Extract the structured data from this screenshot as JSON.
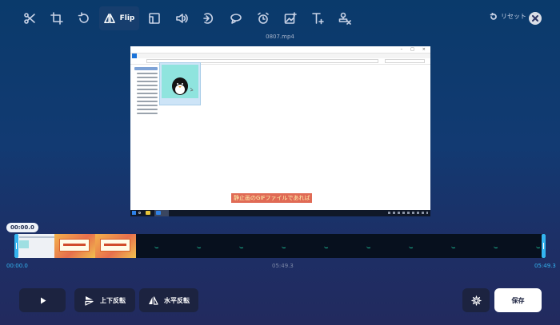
{
  "toolbar": {
    "tools": [
      "cut",
      "crop",
      "rotate",
      "flip",
      "aspect-ratio",
      "volume",
      "speed",
      "loop",
      "timer",
      "add-image",
      "add-text",
      "remove-watermark"
    ],
    "flip_label": "Flip",
    "reset_label": "リセット"
  },
  "preview": {
    "filename": "0807.mp4",
    "caption": "静止画のGIFファイルであれば",
    "caption_bg": "#e06a55",
    "caption_fg": "#fff6b0"
  },
  "timeline": {
    "current_time": "00:00.0",
    "start_time": "00:00.0",
    "mid_time": "05:49.3",
    "end_time": "05:49.3",
    "handle_color": "#34b4f0"
  },
  "controls": {
    "vertical_flip_label": "上下反転",
    "horizontal_flip_label": "水平反転",
    "save_label": "保存"
  }
}
